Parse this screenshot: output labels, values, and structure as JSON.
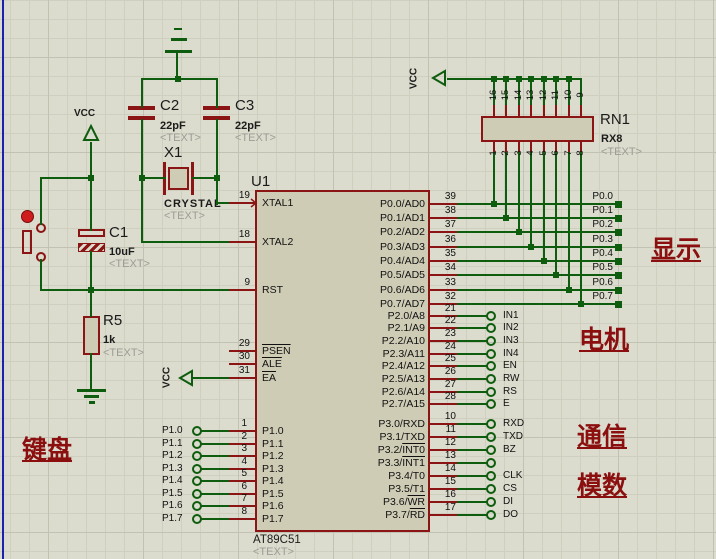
{
  "colors": {
    "background": "#dbdbce",
    "grid_minor": "#cfcfc0",
    "grid_major": "#c2c2b2",
    "wire": "#0e5c0e",
    "pin": "#8b1414",
    "component_outline": "#8b1414",
    "component_fill": "#cfccb6",
    "chip_border": "#8b1515",
    "text": "#1b1b1b",
    "placeholder_text": "#9d9d95",
    "label_red": "#8b0f0f",
    "sheet_border": "#2020b0",
    "button_indicator": "#cf1d1d"
  },
  "annotations": {
    "keyboard": "键盘",
    "display": "显示",
    "motor": "电机",
    "communication": "通信",
    "adc": "模数"
  },
  "power": {
    "vcc_left": "VCC",
    "vcc_ea": "VCC",
    "vcc_rn": "VCC"
  },
  "components": {
    "c2": {
      "ref": "C2",
      "value": "22pF",
      "placeholder": "<TEXT>"
    },
    "c3": {
      "ref": "C3",
      "value": "22pF",
      "placeholder": "<TEXT>"
    },
    "x1": {
      "ref": "X1",
      "value": "CRYSTAL",
      "placeholder": "<TEXT>"
    },
    "c1": {
      "ref": "C1",
      "value": "10uF",
      "placeholder": "<TEXT>"
    },
    "r5": {
      "ref": "R5",
      "value": "1k",
      "placeholder": "<TEXT>"
    },
    "rn1": {
      "ref": "RN1",
      "value": "RX8",
      "placeholder": "<TEXT>",
      "top_pin_numbers": [
        "16",
        "15",
        "14",
        "13",
        "12",
        "11",
        "10",
        "9"
      ],
      "bottom_pin_numbers": [
        "1",
        "2",
        "3",
        "4",
        "5",
        "6",
        "7",
        "8"
      ]
    },
    "u1": {
      "ref": "U1",
      "value": "AT89C51",
      "placeholder": "<TEXT>"
    }
  },
  "u1_pins": {
    "left_control": [
      {
        "num": "19",
        "name": "XTAL1",
        "overline": false
      },
      {
        "num": "18",
        "name": "XTAL2",
        "overline": false
      },
      {
        "num": "9",
        "name": "RST",
        "overline": false
      },
      {
        "num": "29",
        "name": "PSEN",
        "overline": true
      },
      {
        "num": "30",
        "name": "ALE",
        "overline": true
      },
      {
        "num": "31",
        "name": "EA",
        "overline": true
      }
    ],
    "p1": [
      {
        "num": "1",
        "name": "P1.0",
        "net": "P1.0"
      },
      {
        "num": "2",
        "name": "P1.1",
        "net": "P1.1"
      },
      {
        "num": "3",
        "name": "P1.2",
        "net": "P1.2"
      },
      {
        "num": "4",
        "name": "P1.3",
        "net": "P1.3"
      },
      {
        "num": "5",
        "name": "P1.4",
        "net": "P1.4"
      },
      {
        "num": "6",
        "name": "P1.5",
        "net": "P1.5"
      },
      {
        "num": "7",
        "name": "P1.6",
        "net": "P1.6"
      },
      {
        "num": "8",
        "name": "P1.7",
        "net": "P1.7"
      }
    ],
    "p0": [
      {
        "num": "39",
        "name": "P0.0/AD0",
        "net": "P0.0"
      },
      {
        "num": "38",
        "name": "P0.1/AD1",
        "net": "P0.1"
      },
      {
        "num": "37",
        "name": "P0.2/AD2",
        "net": "P0.2"
      },
      {
        "num": "36",
        "name": "P0.3/AD3",
        "net": "P0.3"
      },
      {
        "num": "35",
        "name": "P0.4/AD4",
        "net": "P0.4"
      },
      {
        "num": "34",
        "name": "P0.5/AD5",
        "net": "P0.5"
      },
      {
        "num": "33",
        "name": "P0.6/AD6",
        "net": "P0.6"
      },
      {
        "num": "32",
        "name": "P0.7/AD7",
        "net": "P0.7"
      }
    ],
    "p2": [
      {
        "num": "21",
        "name": "P2.0/A8",
        "terminal": "IN1"
      },
      {
        "num": "22",
        "name": "P2.1/A9",
        "terminal": "IN2"
      },
      {
        "num": "23",
        "name": "P2.2/A10",
        "terminal": "IN3"
      },
      {
        "num": "24",
        "name": "P2.3/A11",
        "terminal": "IN4"
      },
      {
        "num": "25",
        "name": "P2.4/A12",
        "terminal": "EN"
      },
      {
        "num": "26",
        "name": "P2.5/A13",
        "terminal": "RW"
      },
      {
        "num": "27",
        "name": "P2.6/A14",
        "terminal": "RS"
      },
      {
        "num": "28",
        "name": "P2.7/A15",
        "terminal": "E"
      }
    ],
    "p3": [
      {
        "num": "10",
        "name_pre": "P3.0/RXD",
        "name_over": "",
        "terminal": "RXD"
      },
      {
        "num": "11",
        "name_pre": "P3.1/TXD",
        "name_over": "",
        "terminal": "TXD"
      },
      {
        "num": "12",
        "name_pre": "P3.2/",
        "name_over": "INT0",
        "terminal": "BZ"
      },
      {
        "num": "13",
        "name_pre": "P3.3/",
        "name_over": "INT1",
        "terminal": ""
      },
      {
        "num": "14",
        "name_pre": "P3.4/T0",
        "name_over": "",
        "terminal": "CLK"
      },
      {
        "num": "15",
        "name_pre": "P3.5/T1",
        "name_over": "",
        "terminal": "CS"
      },
      {
        "num": "16",
        "name_pre": "P3.6/",
        "name_over": "WR",
        "terminal": "DI"
      },
      {
        "num": "17",
        "name_pre": "P3.7/",
        "name_over": "RD",
        "terminal": "DO"
      }
    ]
  }
}
